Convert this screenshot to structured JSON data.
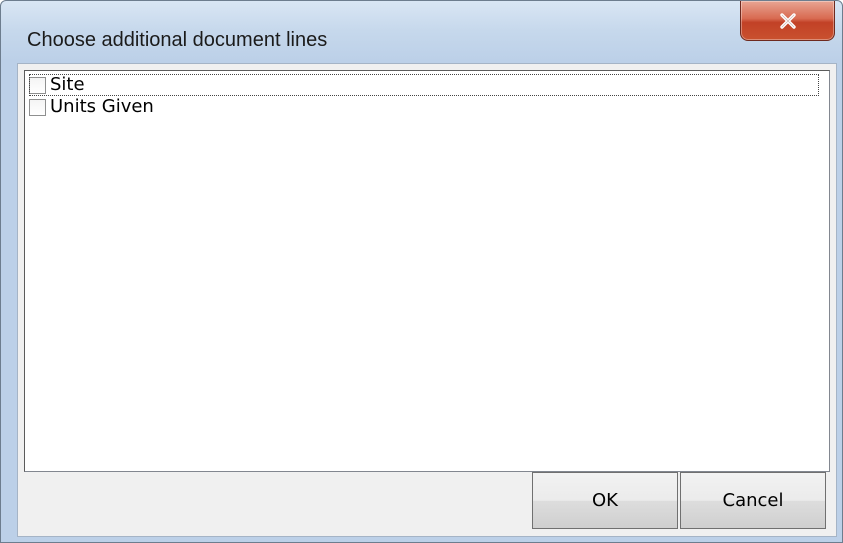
{
  "window": {
    "title": "Choose additional document lines",
    "close_icon": "close-x-icon"
  },
  "list": {
    "items": [
      {
        "label": "Site",
        "checked": false,
        "focused": true
      },
      {
        "label": "Units Given",
        "checked": false,
        "focused": false
      }
    ]
  },
  "buttons": {
    "ok_label": "OK",
    "cancel_label": "Cancel"
  },
  "colors": {
    "close_button": "#c9512f",
    "title_bar": "#c6d8ec"
  }
}
